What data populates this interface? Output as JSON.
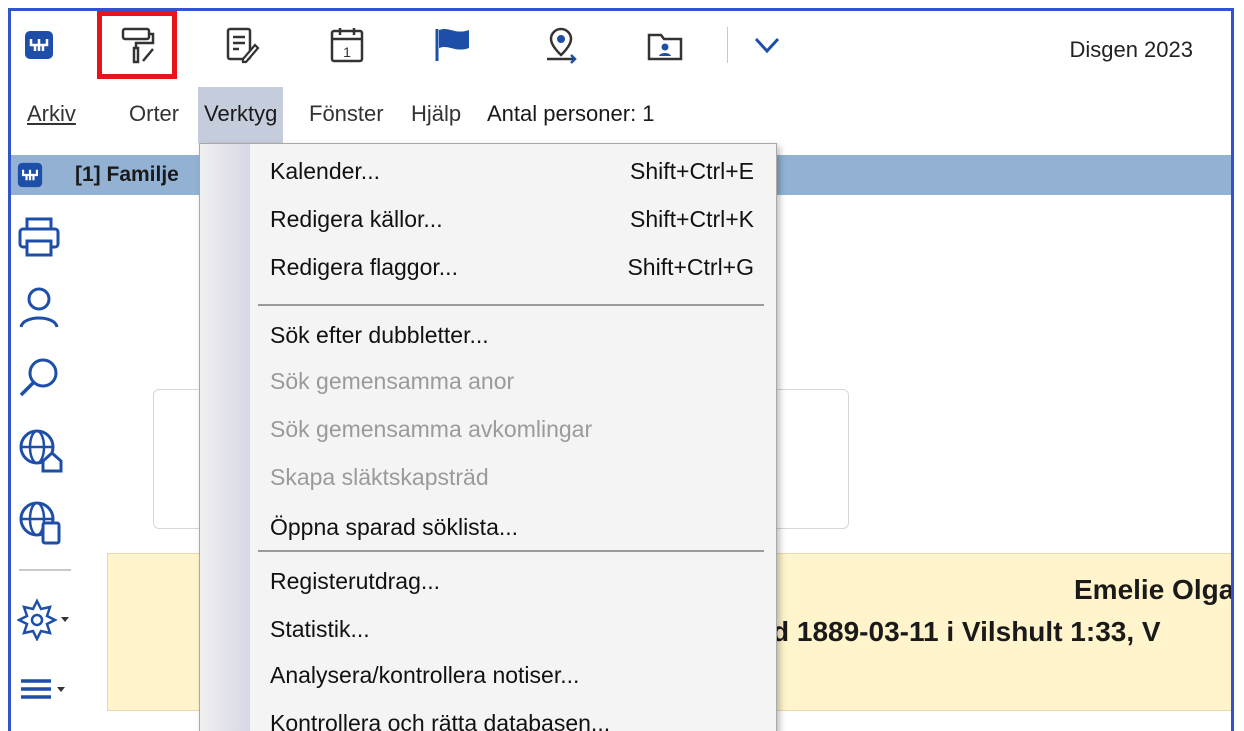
{
  "app": {
    "title": "Disgen 2023"
  },
  "toolbar": {
    "icons": [
      "app-logo-icon",
      "paint-roller-icon",
      "edit-notes-icon",
      "calendar-icon",
      "flag-icon",
      "location-icon",
      "folder-person-icon",
      "dropdown-arrow-icon"
    ],
    "calendar_day": "1"
  },
  "menubar": {
    "items": [
      {
        "label": "Arkiv"
      },
      {
        "label": "Orter"
      },
      {
        "label": "Verktyg"
      },
      {
        "label": "Fönster"
      },
      {
        "label": "Hjälp"
      }
    ],
    "person_count": "Antal personer: 1"
  },
  "window": {
    "title": "[1] Familje"
  },
  "sidebar": {
    "icons": [
      "print-icon",
      "person-icon",
      "search-icon",
      "globe-home-icon",
      "globe-device-icon",
      "settings-dropdown-icon",
      "menu-dropdown-icon"
    ]
  },
  "person": {
    "name": "Emelie Olga* Ols",
    "birth": "d 1889-03-11 i Vilshult 1:33, V"
  },
  "dropdown": {
    "items": [
      {
        "label": "Kalender...",
        "shortcut": "Shift+Ctrl+E",
        "enabled": true
      },
      {
        "label": "Redigera källor...",
        "shortcut": "Shift+Ctrl+K",
        "enabled": true
      },
      {
        "label": "Redigera flaggor...",
        "shortcut": "Shift+Ctrl+G",
        "enabled": true
      },
      {
        "label": "Sök efter dubbletter...",
        "shortcut": "",
        "enabled": true
      },
      {
        "label": "Sök gemensamma anor",
        "shortcut": "",
        "enabled": false
      },
      {
        "label": "Sök gemensamma avkomlingar",
        "shortcut": "",
        "enabled": false
      },
      {
        "label": "Skapa släktskapsträd",
        "shortcut": "",
        "enabled": false
      },
      {
        "label": "Öppna sparad söklista...",
        "shortcut": "",
        "enabled": true
      },
      {
        "label": "Registerutdrag...",
        "shortcut": "",
        "enabled": true
      },
      {
        "label": "Statistik...",
        "shortcut": "",
        "enabled": true
      },
      {
        "label": "Analysera/kontrollera notiser...",
        "shortcut": "",
        "enabled": true
      },
      {
        "label": "Kontrollera och rätta databasen...",
        "shortcut": "",
        "enabled": true
      }
    ]
  },
  "colors": {
    "frame": "#2f55c9",
    "highlight": "#e8141b",
    "window_header": "#93b2d3",
    "person_panel": "#fff4cc",
    "icon_blue": "#1e4fa8"
  }
}
